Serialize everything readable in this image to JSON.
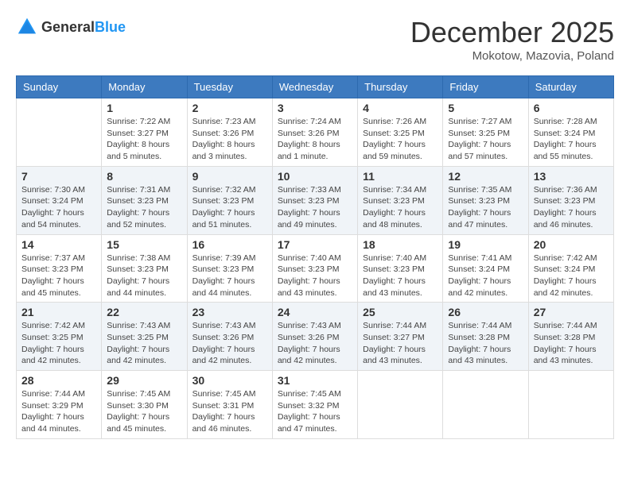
{
  "header": {
    "logo_general": "General",
    "logo_blue": "Blue",
    "month_title": "December 2025",
    "location": "Mokotow, Mazovia, Poland"
  },
  "days_of_week": [
    "Sunday",
    "Monday",
    "Tuesday",
    "Wednesday",
    "Thursday",
    "Friday",
    "Saturday"
  ],
  "weeks": [
    [
      {
        "day": "",
        "info": ""
      },
      {
        "day": "1",
        "info": "Sunrise: 7:22 AM\nSunset: 3:27 PM\nDaylight: 8 hours\nand 5 minutes."
      },
      {
        "day": "2",
        "info": "Sunrise: 7:23 AM\nSunset: 3:26 PM\nDaylight: 8 hours\nand 3 minutes."
      },
      {
        "day": "3",
        "info": "Sunrise: 7:24 AM\nSunset: 3:26 PM\nDaylight: 8 hours\nand 1 minute."
      },
      {
        "day": "4",
        "info": "Sunrise: 7:26 AM\nSunset: 3:25 PM\nDaylight: 7 hours\nand 59 minutes."
      },
      {
        "day": "5",
        "info": "Sunrise: 7:27 AM\nSunset: 3:25 PM\nDaylight: 7 hours\nand 57 minutes."
      },
      {
        "day": "6",
        "info": "Sunrise: 7:28 AM\nSunset: 3:24 PM\nDaylight: 7 hours\nand 55 minutes."
      }
    ],
    [
      {
        "day": "7",
        "info": "Sunrise: 7:30 AM\nSunset: 3:24 PM\nDaylight: 7 hours\nand 54 minutes."
      },
      {
        "day": "8",
        "info": "Sunrise: 7:31 AM\nSunset: 3:23 PM\nDaylight: 7 hours\nand 52 minutes."
      },
      {
        "day": "9",
        "info": "Sunrise: 7:32 AM\nSunset: 3:23 PM\nDaylight: 7 hours\nand 51 minutes."
      },
      {
        "day": "10",
        "info": "Sunrise: 7:33 AM\nSunset: 3:23 PM\nDaylight: 7 hours\nand 49 minutes."
      },
      {
        "day": "11",
        "info": "Sunrise: 7:34 AM\nSunset: 3:23 PM\nDaylight: 7 hours\nand 48 minutes."
      },
      {
        "day": "12",
        "info": "Sunrise: 7:35 AM\nSunset: 3:23 PM\nDaylight: 7 hours\nand 47 minutes."
      },
      {
        "day": "13",
        "info": "Sunrise: 7:36 AM\nSunset: 3:23 PM\nDaylight: 7 hours\nand 46 minutes."
      }
    ],
    [
      {
        "day": "14",
        "info": "Sunrise: 7:37 AM\nSunset: 3:23 PM\nDaylight: 7 hours\nand 45 minutes."
      },
      {
        "day": "15",
        "info": "Sunrise: 7:38 AM\nSunset: 3:23 PM\nDaylight: 7 hours\nand 44 minutes."
      },
      {
        "day": "16",
        "info": "Sunrise: 7:39 AM\nSunset: 3:23 PM\nDaylight: 7 hours\nand 44 minutes."
      },
      {
        "day": "17",
        "info": "Sunrise: 7:40 AM\nSunset: 3:23 PM\nDaylight: 7 hours\nand 43 minutes."
      },
      {
        "day": "18",
        "info": "Sunrise: 7:40 AM\nSunset: 3:23 PM\nDaylight: 7 hours\nand 43 minutes."
      },
      {
        "day": "19",
        "info": "Sunrise: 7:41 AM\nSunset: 3:24 PM\nDaylight: 7 hours\nand 42 minutes."
      },
      {
        "day": "20",
        "info": "Sunrise: 7:42 AM\nSunset: 3:24 PM\nDaylight: 7 hours\nand 42 minutes."
      }
    ],
    [
      {
        "day": "21",
        "info": "Sunrise: 7:42 AM\nSunset: 3:25 PM\nDaylight: 7 hours\nand 42 minutes."
      },
      {
        "day": "22",
        "info": "Sunrise: 7:43 AM\nSunset: 3:25 PM\nDaylight: 7 hours\nand 42 minutes."
      },
      {
        "day": "23",
        "info": "Sunrise: 7:43 AM\nSunset: 3:26 PM\nDaylight: 7 hours\nand 42 minutes."
      },
      {
        "day": "24",
        "info": "Sunrise: 7:43 AM\nSunset: 3:26 PM\nDaylight: 7 hours\nand 42 minutes."
      },
      {
        "day": "25",
        "info": "Sunrise: 7:44 AM\nSunset: 3:27 PM\nDaylight: 7 hours\nand 43 minutes."
      },
      {
        "day": "26",
        "info": "Sunrise: 7:44 AM\nSunset: 3:28 PM\nDaylight: 7 hours\nand 43 minutes."
      },
      {
        "day": "27",
        "info": "Sunrise: 7:44 AM\nSunset: 3:28 PM\nDaylight: 7 hours\nand 43 minutes."
      }
    ],
    [
      {
        "day": "28",
        "info": "Sunrise: 7:44 AM\nSunset: 3:29 PM\nDaylight: 7 hours\nand 44 minutes."
      },
      {
        "day": "29",
        "info": "Sunrise: 7:45 AM\nSunset: 3:30 PM\nDaylight: 7 hours\nand 45 minutes."
      },
      {
        "day": "30",
        "info": "Sunrise: 7:45 AM\nSunset: 3:31 PM\nDaylight: 7 hours\nand 46 minutes."
      },
      {
        "day": "31",
        "info": "Sunrise: 7:45 AM\nSunset: 3:32 PM\nDaylight: 7 hours\nand 47 minutes."
      },
      {
        "day": "",
        "info": ""
      },
      {
        "day": "",
        "info": ""
      },
      {
        "day": "",
        "info": ""
      }
    ]
  ]
}
